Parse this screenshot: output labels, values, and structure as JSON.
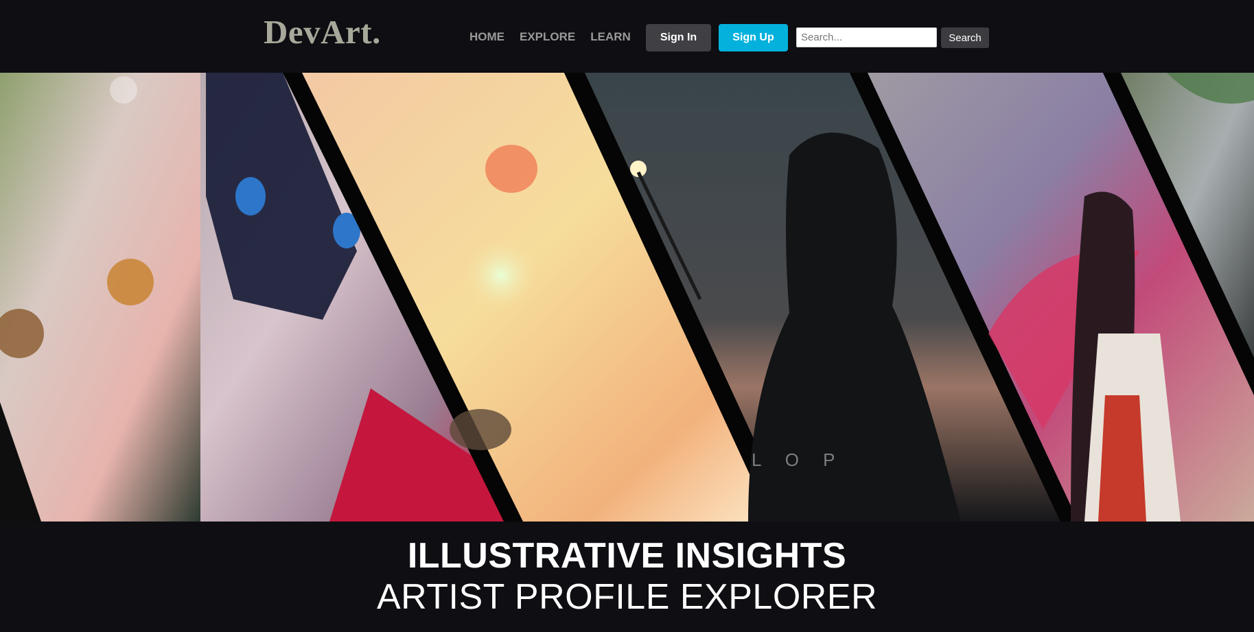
{
  "header": {
    "logo": "DevArt.",
    "nav": [
      {
        "label": "HOME"
      },
      {
        "label": "EXPLORE"
      },
      {
        "label": "LEARN"
      }
    ],
    "sign_in_label": "Sign In",
    "sign_up_label": "Sign Up",
    "search": {
      "placeholder": "Search...",
      "value": "",
      "button_label": "Search"
    }
  },
  "hero": {
    "watermark": "L O P"
  },
  "headline": {
    "title": "ILLUSTRATIVE INSIGHTS",
    "subtitle": "ARTIST PROFILE EXPLORER"
  },
  "colors": {
    "background": "#0e0e13",
    "logo": "#a8a89a",
    "nav_text": "#9a9a9a",
    "sign_in_bg": "#3f3f44",
    "sign_up_bg": "#04b1dc",
    "search_button_bg": "#3c3c40"
  }
}
